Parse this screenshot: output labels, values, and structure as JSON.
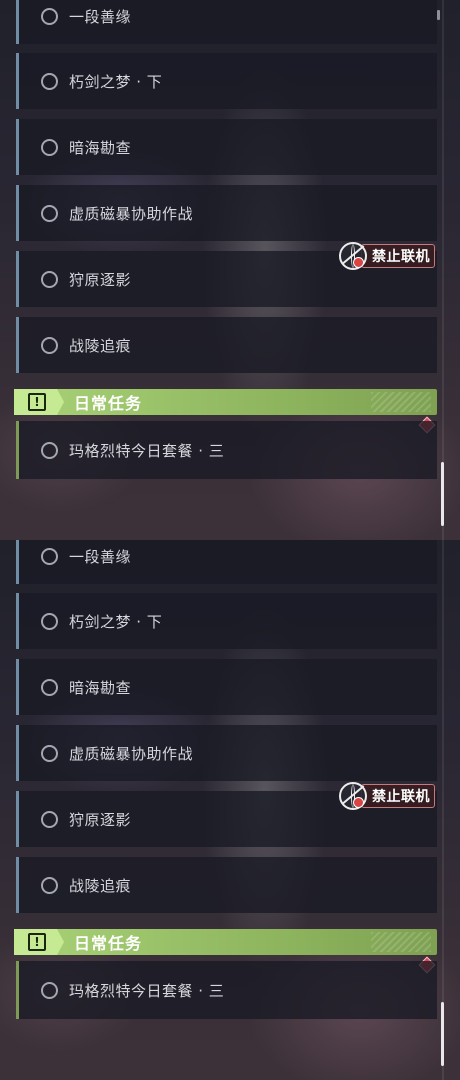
{
  "panels": [
    {
      "tasks": [
        {
          "label": "一段善缘"
        },
        {
          "label": "朽剑之梦 · 下"
        },
        {
          "label": "暗海勘查"
        },
        {
          "label": "虚质磁暴协助作战"
        },
        {
          "label": "狩原逐影"
        },
        {
          "label": "战陵追痕"
        }
      ],
      "badge": {
        "text": "禁止联机",
        "icon": "globe-ban-icon"
      },
      "section": {
        "title": "日常任务",
        "icon": "warning-icon",
        "icon_glyph": "!"
      },
      "daily_tasks": [
        {
          "label": "玛格烈特今日套餐 · 三"
        }
      ]
    },
    {
      "tasks": [
        {
          "label": "一段善缘"
        },
        {
          "label": "朽剑之梦 · 下"
        },
        {
          "label": "暗海勘查"
        },
        {
          "label": "虚质磁暴协助作战"
        },
        {
          "label": "狩原逐影"
        },
        {
          "label": "战陵追痕"
        }
      ],
      "badge": {
        "text": "禁止联机",
        "icon": "globe-ban-icon"
      },
      "section": {
        "title": "日常任务",
        "icon": "warning-icon",
        "icon_glyph": "!"
      },
      "daily_tasks": [
        {
          "label": "玛格烈特今日套餐 · 三"
        }
      ]
    }
  ],
  "colors": {
    "quest_accent": "#6f8ea6",
    "daily_accent": "#a9d277",
    "alert": "#d94b58"
  }
}
